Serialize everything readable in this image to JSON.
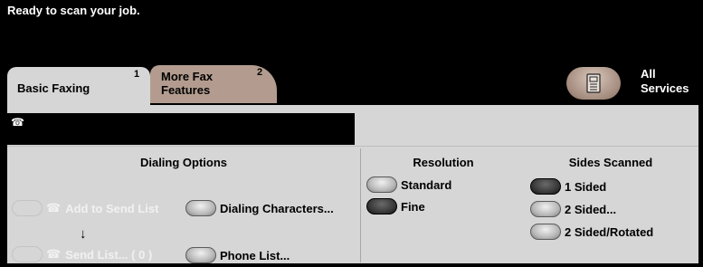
{
  "status": {
    "message": "Ready to scan your job."
  },
  "tabs": [
    {
      "label": "Basic Faxing",
      "number": "1"
    },
    {
      "label_line1": "More Fax",
      "label_line2": "Features",
      "number": "2"
    }
  ],
  "all_services": {
    "line1": "All",
    "line2": "Services"
  },
  "fax_number_field": {
    "icon": "☎"
  },
  "dialing_options": {
    "heading": "Dialing Options",
    "add_to_send_list": "Add to Send List",
    "send_list": "Send List... ( 0 )",
    "dialing_characters": "Dialing Characters...",
    "phone_list": "Phone List...",
    "phone_icon": "☎",
    "arrow": "↓"
  },
  "resolution": {
    "heading": "Resolution",
    "options": [
      "Standard",
      "Fine"
    ],
    "selected": "Fine"
  },
  "sides_scanned": {
    "heading": "Sides Scanned",
    "options": [
      "1 Sided",
      "2 Sided...",
      "2 Sided/Rotated"
    ],
    "selected": "1 Sided"
  }
}
